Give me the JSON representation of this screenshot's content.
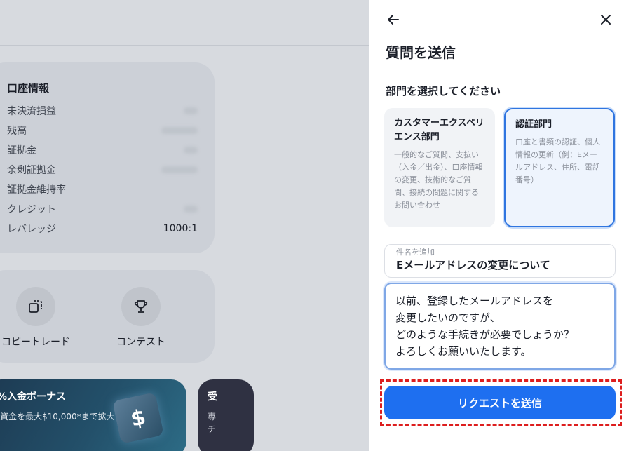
{
  "background": {
    "account": {
      "title": "口座情報",
      "rows": [
        {
          "label": "未決済損益",
          "value": ""
        },
        {
          "label": "残高",
          "value": ""
        },
        {
          "label": "証拠金",
          "value": ""
        },
        {
          "label": "余剰証拠金",
          "value": ""
        },
        {
          "label": "証拠金維持率",
          "value": ""
        },
        {
          "label": "クレジット",
          "value": ""
        },
        {
          "label": "レバレッジ",
          "value": "1000:1"
        }
      ]
    },
    "tools": [
      {
        "label": "コピートレード",
        "icon": "copy-icon"
      },
      {
        "label": "コンテスト",
        "icon": "trophy-icon"
      }
    ],
    "banner": {
      "title": "%入金ボーナス",
      "subtitle": "資金を最大$10,000*まで拡大",
      "symbol": "$"
    },
    "banner2": {
      "title": "受",
      "subtitle": "専チ"
    }
  },
  "panel": {
    "back_icon": "arrow-left-icon",
    "close_icon": "close-icon",
    "title": "質問を送信",
    "department_label": "部門を選択してください",
    "departments": [
      {
        "title": "カスタマーエクスペリエンス部門",
        "description": "一般的なご質問、支払い（入金／出金）、口座情報の変更、技術的なご質問、接続の問題に関するお問い合わせ",
        "selected": false
      },
      {
        "title": "認証部門",
        "description": "口座と書類の認証、個人情報の更新（例：Eメールアドレス、住所、電話番号）",
        "selected": true
      }
    ],
    "subject": {
      "placeholder": "件名を追加",
      "value": "Eメールアドレスの変更について"
    },
    "message": "以前、登録したメールアドレスを\n変更したいのですが、\nどのような手続きが必要でしょうか？\nよろしくお願いいたします。",
    "submit_label": "リクエストを送信",
    "colors": {
      "accent": "#1e6ff0",
      "selected_border": "#2f75e0",
      "highlight_outline": "#dd1e1e"
    }
  }
}
